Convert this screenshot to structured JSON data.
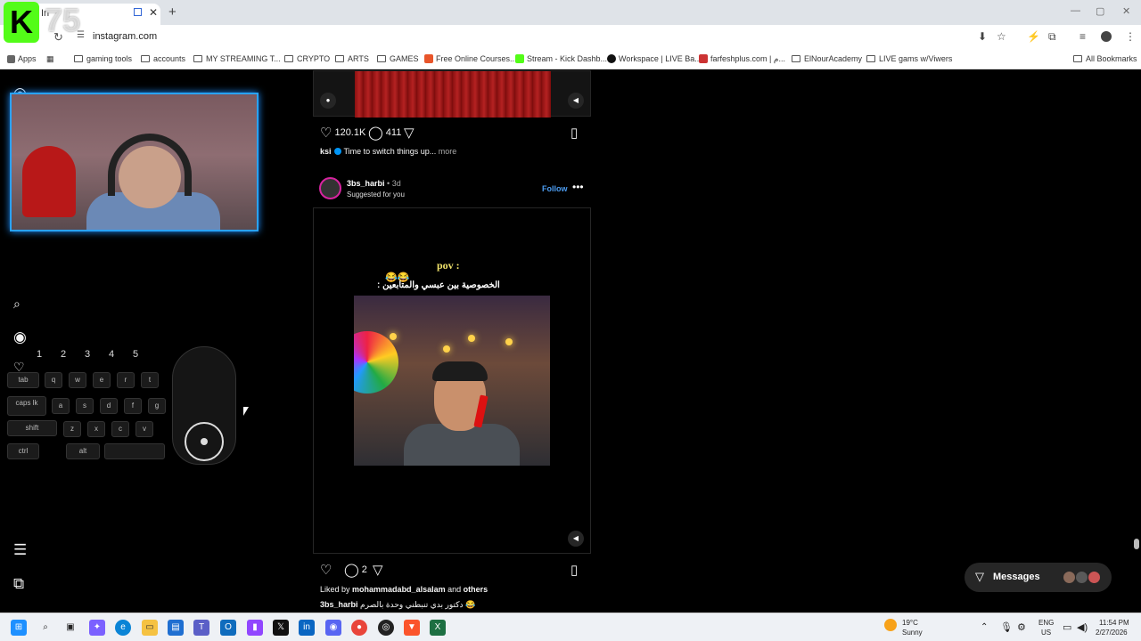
{
  "browser": {
    "tab_title": "In",
    "url": "instagram.com",
    "bookmarks": [
      {
        "label": "Apps"
      },
      {
        "label": "gaming tools"
      },
      {
        "label": "accounts"
      },
      {
        "label": "MY STREAMING T..."
      },
      {
        "label": "CRYPTO"
      },
      {
        "label": "ARTS"
      },
      {
        "label": "GAMES"
      },
      {
        "label": "Free Online Courses..."
      },
      {
        "label": "Stream - Kick Dashb..."
      },
      {
        "label": "Workspace | LIVE Ba..."
      },
      {
        "label": "farfeshplus.com | م..."
      },
      {
        "label": "ElNourAcademy"
      },
      {
        "label": "LIVE gams w/Viwers"
      },
      {
        "label": "All Bookmarks"
      }
    ]
  },
  "overlay": {
    "logo": "K",
    "viewer_count": "75"
  },
  "input_overlay": {
    "number_keys": [
      "1",
      "2",
      "3",
      "4",
      "5"
    ],
    "keys": {
      "tab": "tab",
      "q": "q",
      "w": "w",
      "e": "e",
      "r": "r",
      "t": "t",
      "caps": "caps lk",
      "a": "a",
      "s": "s",
      "d": "d",
      "f": "f",
      "g": "g",
      "shift": "shift",
      "z": "z",
      "x": "x",
      "c": "c",
      "v": "v",
      "ctrl": "ctrl",
      "alt": "alt"
    }
  },
  "post1": {
    "likes": "120.1K",
    "comments": "411",
    "author": "ksi",
    "caption": "Time to switch things up...",
    "more": "more"
  },
  "post2": {
    "username": "3bs_harbi",
    "age": "3d",
    "subtitle": "Suggested for you",
    "follow": "Follow",
    "video_title": "pov :",
    "video_subtitle": "الخصوصية بين عبسي والمتابعين :",
    "video_emoji": "😂😂",
    "comments": "2",
    "liked_by_prefix": "Liked by",
    "liked_by_user": "mohammadabd_alsalam",
    "liked_by_and": "and",
    "liked_by_others": "others",
    "caption_user": "3bs_harbi",
    "caption": "دكتور بدي تنبطني وحدة بالصرم 😂"
  },
  "messages": {
    "label": "Messages"
  },
  "taskbar": {
    "weather_temp": "19°C",
    "weather_desc": "Sunny",
    "lang1": "ENG",
    "lang2": "US",
    "time": "11:54 PM",
    "date": "2/27/2026"
  },
  "colors": {
    "instagram_blue": "#0095f6",
    "follow_blue": "#4c9cf0",
    "kick_green": "#53fc18",
    "webcam_border": "#29a3ff"
  }
}
